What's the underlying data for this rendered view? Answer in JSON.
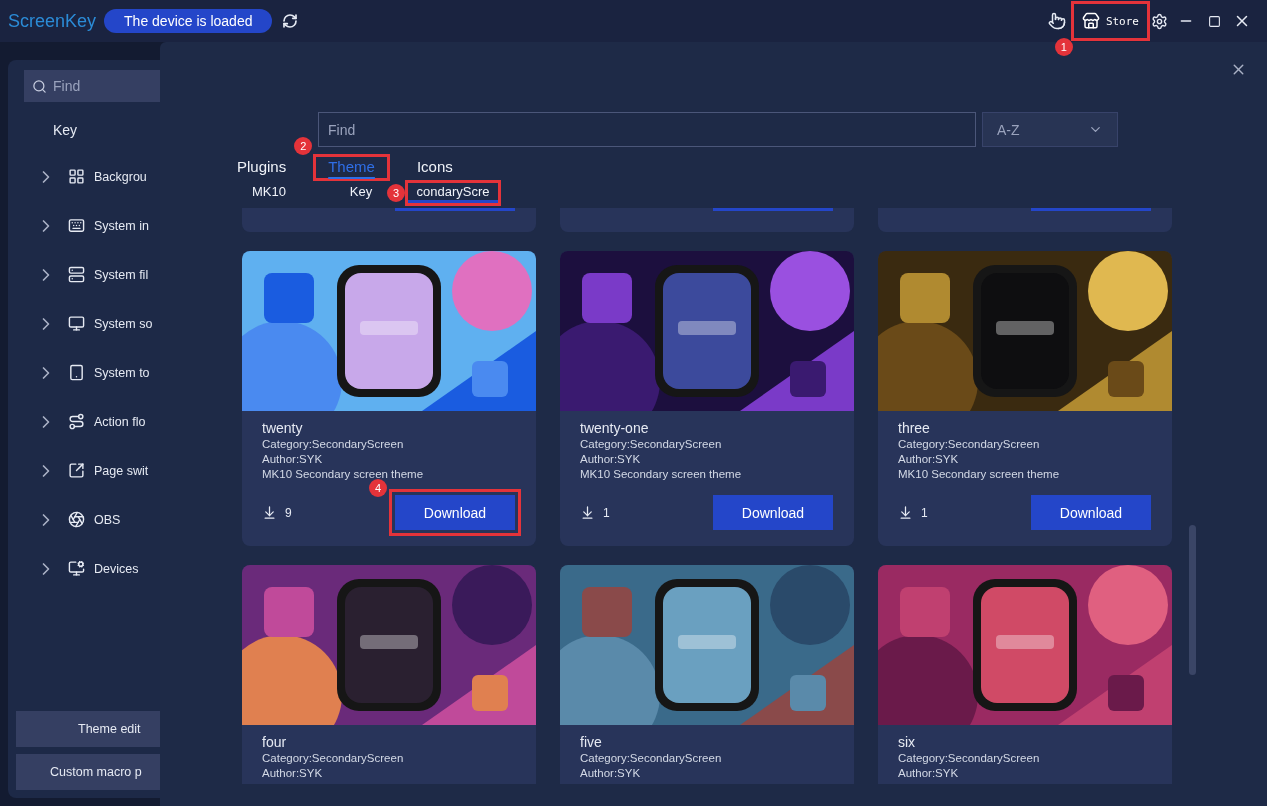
{
  "app": {
    "logo": "ScreenKey",
    "status": "The device is loaded"
  },
  "toolbar": {
    "store": {
      "label": "Store",
      "highlighted": true,
      "annotation": "1"
    }
  },
  "sidebar": {
    "search": {
      "placeholder": "Find"
    },
    "section": "Key",
    "items": [
      {
        "label": "Backgrou",
        "expanded": false
      },
      {
        "label": "System in",
        "expanded": false
      },
      {
        "label": "System fil",
        "expanded": false
      },
      {
        "label": "System so",
        "expanded": false
      },
      {
        "label": "System to",
        "expanded": false
      },
      {
        "label": "Action flo",
        "expanded": false
      },
      {
        "label": "Page swit",
        "expanded": false
      },
      {
        "label": "OBS",
        "expanded": false
      },
      {
        "label": "Devices",
        "expanded": false
      }
    ],
    "buttons": [
      "Theme edit",
      "Custom macro p"
    ]
  },
  "store": {
    "search": {
      "placeholder": "Find"
    },
    "sort": "A-Z",
    "tabs": [
      {
        "label": "Plugins",
        "selected": false,
        "highlighted": false
      },
      {
        "label": "Theme",
        "selected": true,
        "highlighted": true,
        "annotation": "2"
      },
      {
        "label": "Icons",
        "selected": false,
        "highlighted": false
      }
    ],
    "subtabs": [
      {
        "label": "MK10",
        "selected": false,
        "highlighted": false
      },
      {
        "label": "Key",
        "selected": false,
        "highlighted": false
      },
      {
        "label": "condaryScre",
        "selected": true,
        "highlighted": true,
        "annotation": "3"
      }
    ],
    "partial_cards": [
      {
        "kind": "cut"
      },
      {
        "kind": "cut"
      },
      {
        "kind": "cut"
      }
    ],
    "cards": [
      {
        "title": "twenty",
        "category": "Category:SecondaryScreen",
        "author": "Author:SYK",
        "description": "MK10 Secondary screen theme",
        "downloads": "9",
        "button": "Download",
        "highlighted": true,
        "annotation": "4"
      },
      {
        "title": "twenty-one",
        "category": "Category:SecondaryScreen",
        "author": "Author:SYK",
        "description": "MK10 Secondary screen theme",
        "downloads": "1",
        "button": "Download",
        "highlighted": false
      },
      {
        "title": "three",
        "category": "Category:SecondaryScreen",
        "author": "Author:SYK",
        "description": "MK10 Secondary screen theme",
        "downloads": "1",
        "button": "Download",
        "highlighted": false
      },
      {
        "title": "four",
        "category": "Category:SecondaryScreen",
        "author": "Author:SYK"
      },
      {
        "title": "five",
        "category": "Category:SecondaryScreen",
        "author": "Author:SYK"
      },
      {
        "title": "six",
        "category": "Category:SecondaryScreen",
        "author": "Author:SYK"
      }
    ]
  }
}
